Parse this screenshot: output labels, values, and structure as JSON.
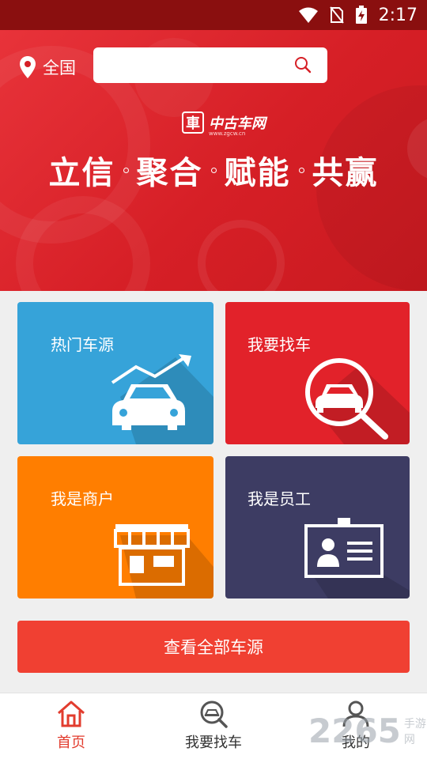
{
  "status_bar": {
    "time": "2:17"
  },
  "header": {
    "location": "全国",
    "search": {
      "value": "",
      "placeholder": ""
    }
  },
  "banner": {
    "logo_mark": "車",
    "logo_text": "中古车网",
    "logo_sub": "www.zgcw.cn",
    "slogan": [
      "立信",
      "聚合",
      "赋能",
      "共赢"
    ]
  },
  "tiles": [
    {
      "label": "热门车源",
      "color": "#36a3d9",
      "icon": "car-trend-icon"
    },
    {
      "label": "我要找车",
      "color": "#e2222a",
      "icon": "car-search-icon"
    },
    {
      "label": "我是商户",
      "color": "#ff7e00",
      "icon": "shop-icon"
    },
    {
      "label": "我是员工",
      "color": "#3d3c63",
      "icon": "id-card-icon"
    }
  ],
  "cta": {
    "label": "查看全部车源"
  },
  "tabbar": {
    "tabs": [
      {
        "label": "首页",
        "icon": "home-icon",
        "active": true
      },
      {
        "label": "我要找车",
        "icon": "car-search-tab-icon",
        "active": false
      },
      {
        "label": "我的",
        "icon": "user-icon",
        "active": false
      }
    ]
  },
  "watermark": {
    "number": "2265",
    "text": "手游网"
  },
  "colors": {
    "brand_red": "#e23c2e",
    "banner_red": "#d61f26",
    "status_bar": "#8a0f0f"
  }
}
